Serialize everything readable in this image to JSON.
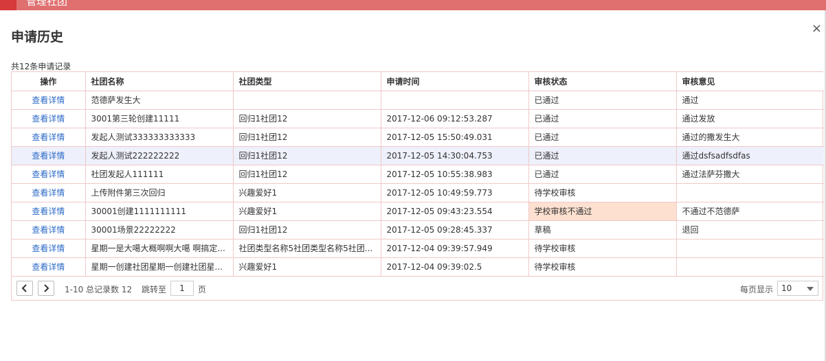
{
  "top_bar": {
    "title": "管理社团"
  },
  "modal": {
    "title": "申请历史",
    "close": "×"
  },
  "record_count": "共12条申请记录",
  "table": {
    "headers": [
      "操作",
      "社团名称",
      "社团类型",
      "申请时间",
      "审核状态",
      "审核意见"
    ],
    "rows": [
      {
        "action": "查看详情",
        "name": "范德萨发生大",
        "type": "",
        "time": "",
        "status": "已通过",
        "opinion": "通过"
      },
      {
        "action": "查看详情",
        "name": "3001第三轮创建11111",
        "type": "回归1社团12",
        "time": "2017-12-06 09:12:53.287",
        "status": "已通过",
        "opinion": "通过发放"
      },
      {
        "action": "查看详情",
        "name": "发起人测试333333333333",
        "type": "回归1社团12",
        "time": "2017-12-05 15:50:49.031",
        "status": "已通过",
        "opinion": "通过的撒发生大"
      },
      {
        "action": "查看详情",
        "name": "发起人测试222222222",
        "type": "回归1社团12",
        "time": "2017-12-05 14:30:04.753",
        "status": "已通过",
        "opinion": "通过dsfsadfsdfas"
      },
      {
        "action": "查看详情",
        "name": "社团发起人111111",
        "type": "回归1社团12",
        "time": "2017-12-05 10:55:38.983",
        "status": "已通过",
        "opinion": "通过法萨芬撒大"
      },
      {
        "action": "查看详情",
        "name": "上传附件第三次回归",
        "type": "兴趣爱好1",
        "time": "2017-12-05 10:49:59.773",
        "status": "待学校审核",
        "opinion": ""
      },
      {
        "action": "查看详情",
        "name": "30001创建1111111111",
        "type": "兴趣爱好1",
        "time": "2017-12-05 09:43:23.554",
        "status": "学校审核不通过",
        "opinion": "不通过不范德萨"
      },
      {
        "action": "查看详情",
        "name": "30001场景22222222",
        "type": "回归1社团12",
        "time": "2017-12-05 09:28:45.337",
        "status": "草稿",
        "opinion": "退回"
      },
      {
        "action": "查看详情",
        "name": "星期一是大噶大概啊啊大噶 啊搞定...",
        "type": "社团类型名称5社团类型名称5社团...",
        "time": "2017-12-04 09:39:57.949",
        "status": "待学校审核",
        "opinion": ""
      },
      {
        "action": "查看详情",
        "name": "星期一创建社团星期一创建社团星...",
        "type": "兴趣爱好1",
        "time": "2017-12-04 09:39:02.5",
        "status": "待学校审核",
        "opinion": ""
      }
    ]
  },
  "pager": {
    "info": "1-10 总记录数 12",
    "jump_label": "跳转至",
    "page_value": "1",
    "page_unit": "页",
    "page_size_label": "每页显示",
    "page_size": "10"
  },
  "icons": {
    "prev": "chevron-left-icon",
    "next": "chevron-right-icon",
    "close": "close-icon"
  },
  "colors": {
    "header_bar": "#e06f6f",
    "link": "#2d6bc7",
    "grid_border": "#f0c8c8",
    "fail_status_bg": "#fde0d0",
    "highlight_row": "#eef0fb"
  }
}
